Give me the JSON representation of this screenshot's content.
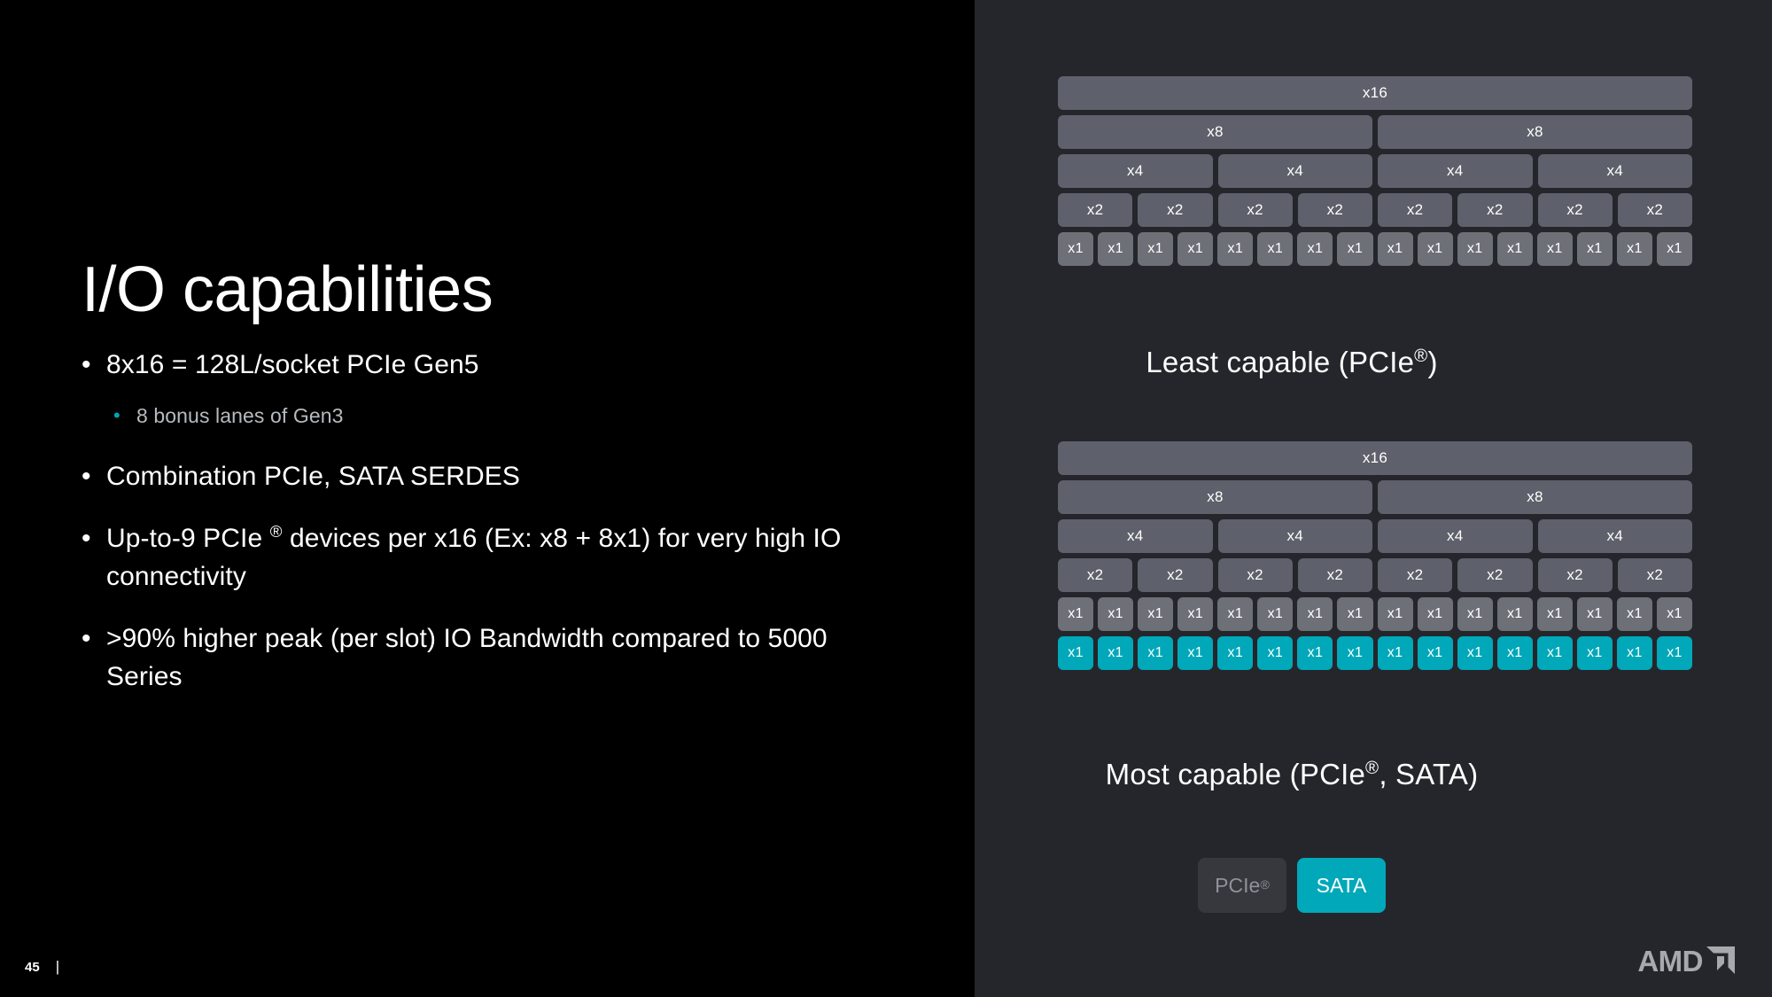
{
  "slide": {
    "title": "I/O capabilities",
    "page_number": "45",
    "footer_divider": "|",
    "brand": "AMD",
    "background_left": "#000000",
    "background_right": "#24262b",
    "accent_teal": "#00a8b9",
    "lane_box_color": "#5e616b",
    "lane_x1_color": "#6d7077"
  },
  "bullets": [
    {
      "level": 1,
      "mark": "•",
      "text": "8x16 = 128L/socket PCIe Gen5"
    },
    {
      "level": 2,
      "mark": "•",
      "text": "8 bonus lanes of Gen3"
    },
    {
      "level": 1,
      "mark": "•",
      "text": "Combination PCIe, SATA SERDES"
    },
    {
      "level": 1,
      "mark": "•",
      "text_pre": "Up-to-9 PCIe ",
      "text_reg": "®",
      "text_post": " devices per x16 (Ex: x8 + 8x1) for very high IO connectivity"
    },
    {
      "level": 1,
      "mark": "•",
      "text": ">90% higher peak (per slot) IO Bandwidth compared to 5000 Series"
    }
  ],
  "diagrams": [
    {
      "id": "top",
      "caption_pre": "Least capable (PCIe",
      "caption_reg": "®",
      "caption_post": ")",
      "rows": [
        {
          "label": "x16",
          "count": 1,
          "type": "pcie"
        },
        {
          "label": "x8",
          "count": 2,
          "type": "pcie"
        },
        {
          "label": "x4",
          "count": 4,
          "type": "pcie"
        },
        {
          "label": "x2",
          "count": 8,
          "type": "pcie"
        },
        {
          "label": "x1",
          "count": 16,
          "type": "pcie"
        }
      ]
    },
    {
      "id": "bottom",
      "caption_pre": "Most capable (PCIe",
      "caption_reg": "®",
      "caption_post": ", SATA)",
      "rows": [
        {
          "label": "x16",
          "count": 1,
          "type": "pcie"
        },
        {
          "label": "x8",
          "count": 2,
          "type": "pcie"
        },
        {
          "label": "x4",
          "count": 4,
          "type": "pcie"
        },
        {
          "label": "x2",
          "count": 8,
          "type": "pcie"
        },
        {
          "label": "x1",
          "count": 16,
          "type": "pcie"
        },
        {
          "label": "x1",
          "count": 16,
          "type": "sata"
        }
      ]
    }
  ],
  "legend": [
    {
      "label_pre": "PCIe",
      "label_reg": "®",
      "type": "pcie"
    },
    {
      "label_pre": "SATA",
      "label_reg": "",
      "type": "sata"
    }
  ]
}
